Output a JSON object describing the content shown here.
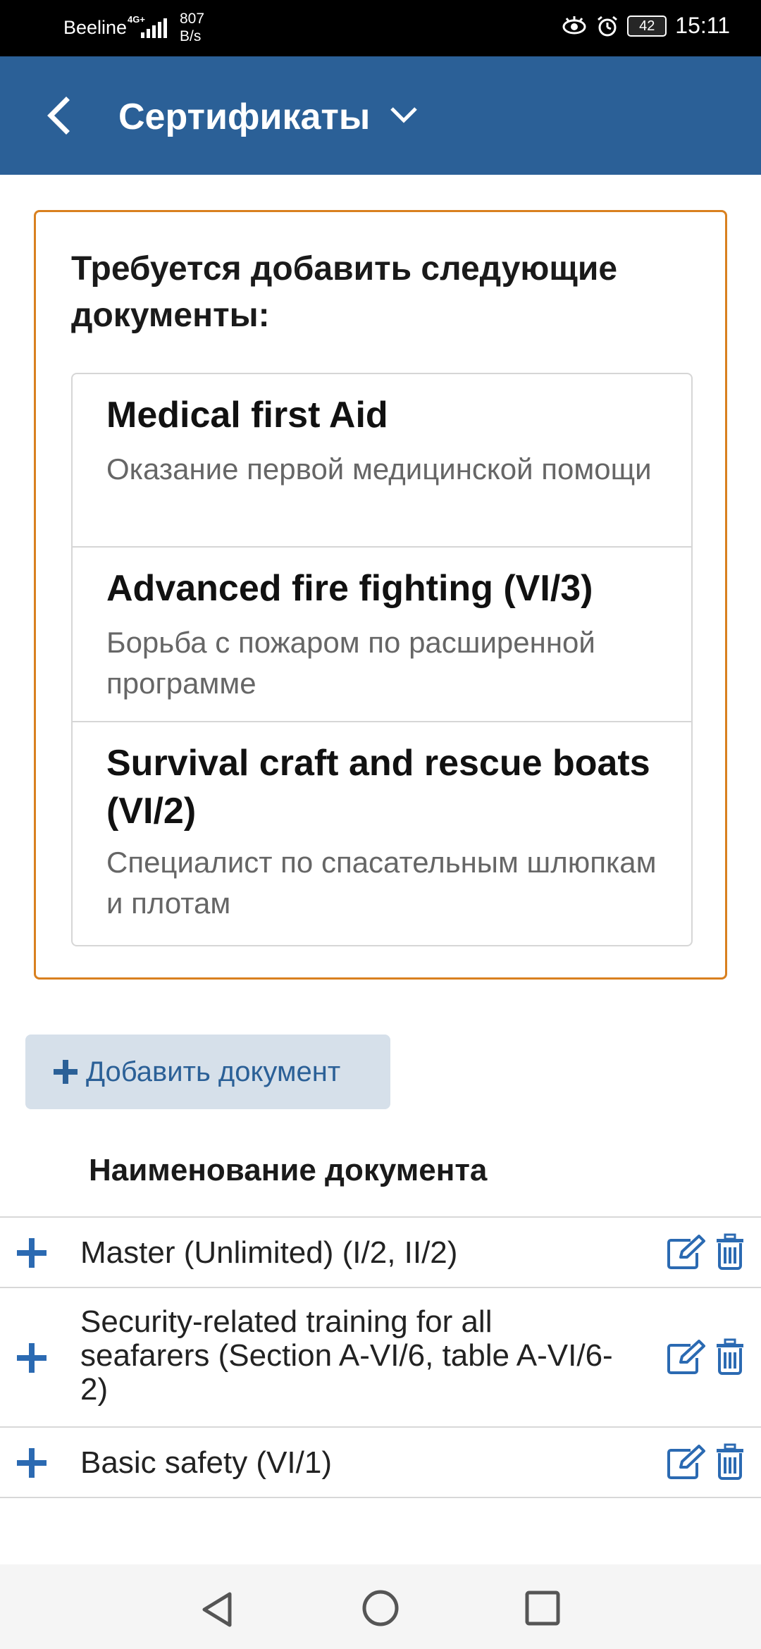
{
  "status_bar": {
    "carrier": "Beeline",
    "network": "4G+",
    "speed_value": "807",
    "speed_unit": "B/s",
    "battery": "42",
    "time": "15:11"
  },
  "app_bar": {
    "title": "Сертификаты"
  },
  "requirements": {
    "heading": "Требуется добавить следующие документы:",
    "items": [
      {
        "title": "Medical first Aid",
        "subtitle": "Оказание первой медицинской помощи"
      },
      {
        "title": "Advanced fire fighting (VI/3)",
        "subtitle": "Борьба с пожаром по расширенной программе"
      },
      {
        "title": "Survival craft and rescue boats (VI/2)",
        "subtitle": "Специалист по спасательным шлюпкам и плотам"
      }
    ]
  },
  "add_button": {
    "label": "Добавить документ"
  },
  "documents_table": {
    "header": "Наименование документа",
    "rows": [
      {
        "name": "Master (Unlimited) (I/2, II/2)"
      },
      {
        "name": "Security-related training for all seafarers (Section A-VI/6, table A-VI/6-2)"
      },
      {
        "name": "Basic safety (VI/1)"
      }
    ]
  },
  "colors": {
    "app_bar": "#2b6097",
    "accent_border": "#d9801f",
    "icon_blue": "#2b6ab2",
    "add_button_bg": "#d6e0ea"
  },
  "icons": {
    "back": "arrow-left-icon",
    "title_dropdown": "chevron-down-icon",
    "add": "plus-icon",
    "row_expand": "plus-icon",
    "row_edit": "edit-icon",
    "row_delete": "trash-icon",
    "nav_back": "triangle-back-icon",
    "nav_home": "circle-home-icon",
    "nav_recent": "square-recent-icon"
  }
}
